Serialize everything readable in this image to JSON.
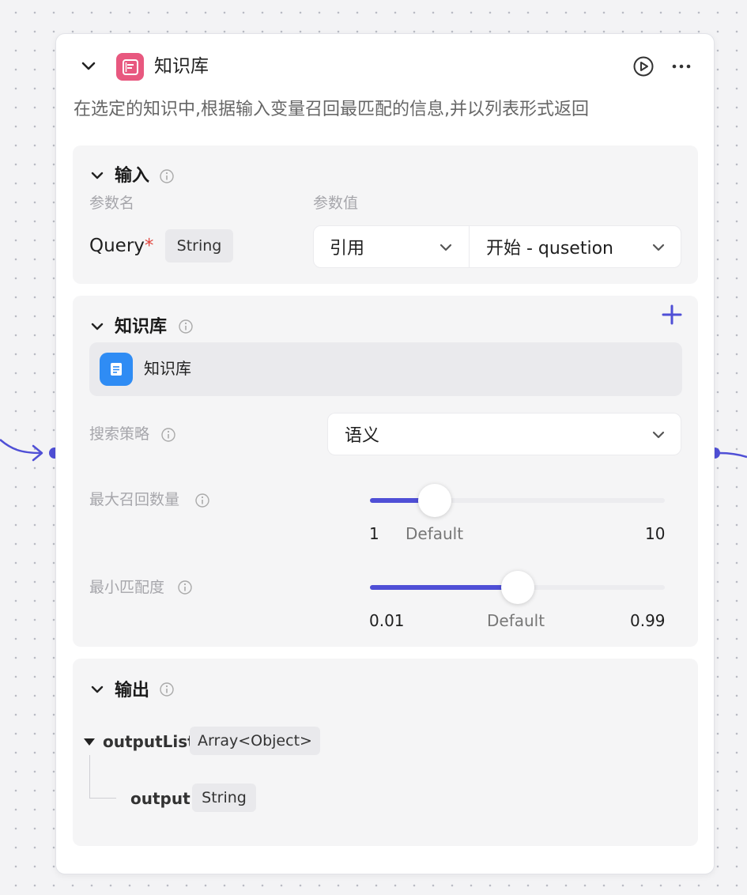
{
  "node": {
    "title": "知识库",
    "description": "在选定的知识中,根据输入变量召回最匹配的信息,并以列表形式返回",
    "brand_color": "#e8587f",
    "accent_color": "#4f4fd6"
  },
  "input_section": {
    "title": "输入",
    "col_param_name": "参数名",
    "col_param_value": "参数值",
    "param": {
      "name": "Query",
      "required_mark": "*",
      "type": "String",
      "source_mode": "引用",
      "reference": "开始 - qusetion"
    }
  },
  "kb_section": {
    "title": "知识库",
    "items": [
      {
        "name": "知识库",
        "icon": "document-icon",
        "color": "#2f8cf4"
      }
    ],
    "search_strategy": {
      "label": "搜索策略",
      "value": "语义"
    },
    "max_recall": {
      "label": "最大召回数量",
      "min": "1",
      "max": "10",
      "default_label": "Default",
      "value_fraction": 0.22
    },
    "min_match": {
      "label": "最小匹配度",
      "min": "0.01",
      "max": "0.99",
      "default_label": "Default",
      "value_fraction": 0.5
    }
  },
  "output_section": {
    "title": "输出",
    "list_name": "outputList",
    "list_type": "Array<Object>",
    "child_name": "output",
    "child_type": "String"
  }
}
